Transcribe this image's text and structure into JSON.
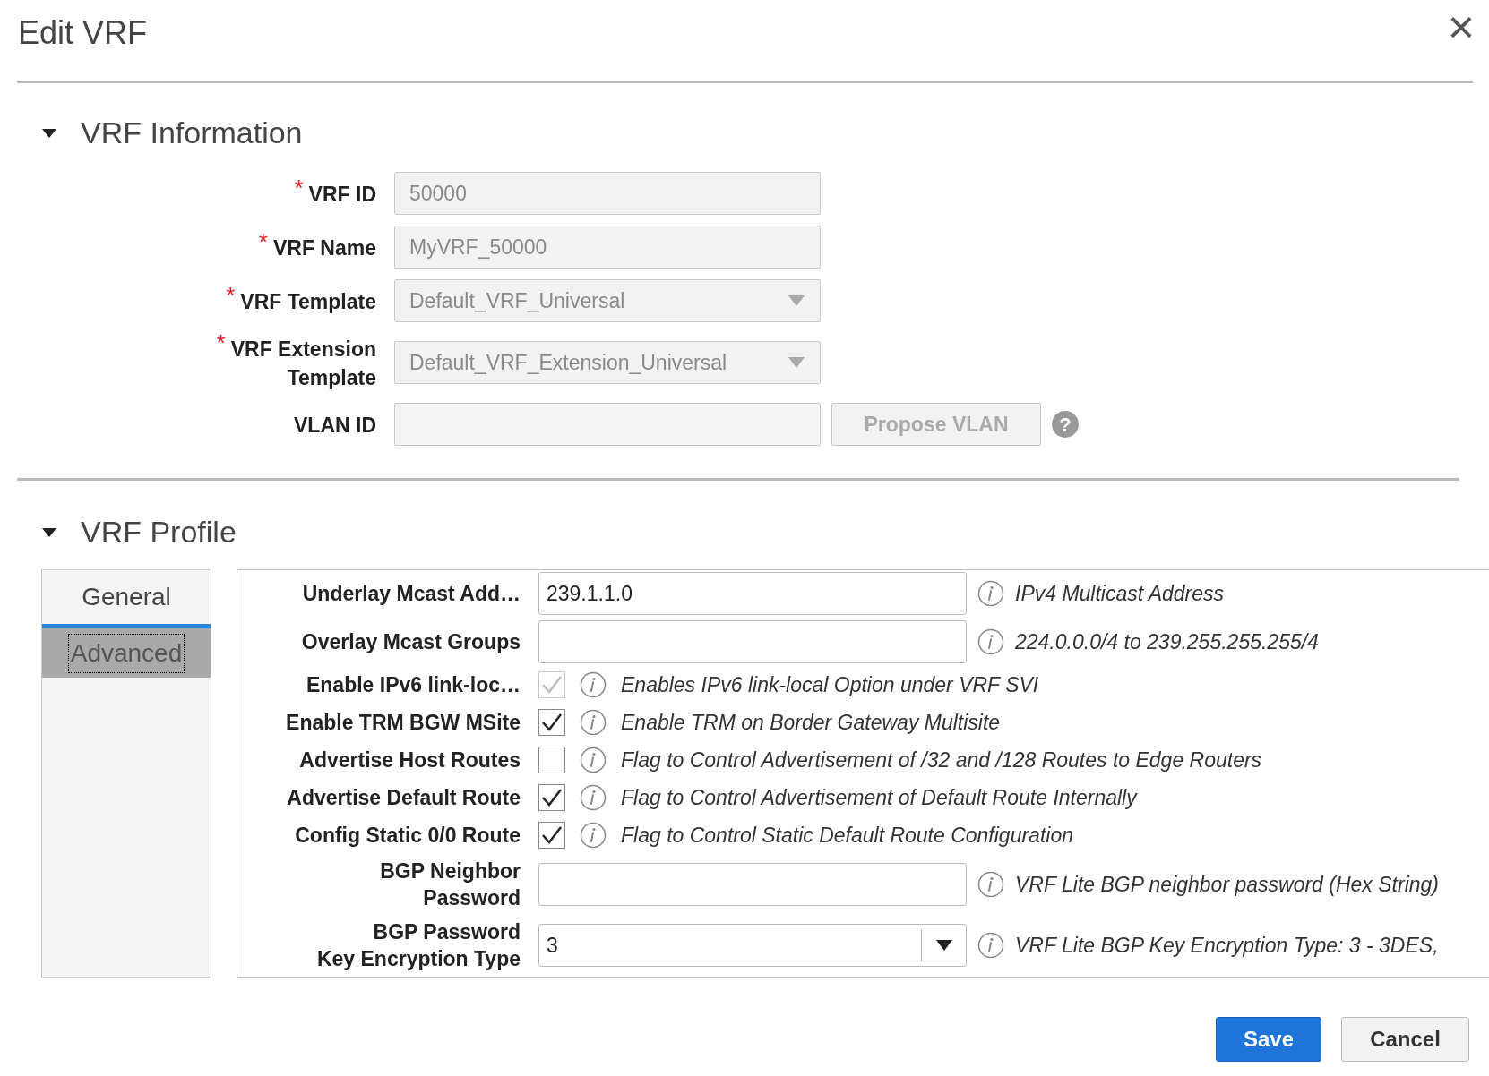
{
  "dialog": {
    "title": "Edit VRF",
    "close": "×"
  },
  "vrf_information": {
    "title": "VRF Information",
    "expanded": true,
    "fields": [
      {
        "kind": "input",
        "label": "VRF ID",
        "required_mark": "*",
        "value": "50000",
        "disabled": true
      },
      {
        "kind": "input",
        "label": "VRF Name",
        "required_mark": "*",
        "value": "MyVRF_50000",
        "disabled": true
      },
      {
        "kind": "select",
        "label": "VRF Template",
        "required_mark": "*",
        "value": "Default_VRF_Universal",
        "disabled": true
      },
      {
        "kind": "select",
        "label": "VRF Extension\nTemplate",
        "required_mark": "*",
        "value": "Default_VRF_Extension_Universal",
        "disabled": true
      },
      {
        "kind": "vlan",
        "label": "VLAN ID",
        "disabled": false,
        "button": "Propose VLAN",
        "help": "?"
      }
    ]
  },
  "vrf_profile": {
    "title": "VRF Profile",
    "expanded": true,
    "tabs": [
      {
        "label": "General",
        "selected": false
      },
      {
        "label": "Advanced",
        "selected": true
      }
    ],
    "rows": [
      {
        "kind": "input",
        "label": "Underlay Mcast Add…",
        "value": "239.1.1.0",
        "hint": "IPv4 Multicast Address"
      },
      {
        "kind": "input",
        "label": "Overlay Mcast Groups",
        "value": "",
        "hint": "224.0.0.0/4 to 239.255.255.255/4"
      },
      {
        "kind": "checkbox",
        "label": "Enable IPv6 link-loc…",
        "checked": true,
        "disabled": true,
        "hint": "Enables IPv6 link-local Option under VRF SVI"
      },
      {
        "kind": "checkbox",
        "label": "Enable TRM BGW MSite",
        "checked": true,
        "disabled": false,
        "hint": "Enable TRM on Border Gateway Multisite"
      },
      {
        "kind": "checkbox",
        "label": "Advertise Host Routes",
        "checked": false,
        "disabled": false,
        "hint": "Flag to Control Advertisement of /32 and /128 Routes to Edge Routers"
      },
      {
        "kind": "checkbox",
        "label": "Advertise Default Route",
        "checked": true,
        "disabled": false,
        "hint": "Flag to Control Advertisement of Default Route Internally"
      },
      {
        "kind": "checkbox",
        "label": "Config Static 0/0 Route",
        "checked": true,
        "disabled": false,
        "hint": "Flag to Control Static Default Route Configuration"
      },
      {
        "kind": "input",
        "label": "BGP Neighbor\nPassword",
        "value": "",
        "hint": "VRF Lite BGP neighbor password (Hex String)"
      },
      {
        "kind": "select",
        "label": "BGP Password\nKey Encryption Type",
        "value": "3",
        "hint": "VRF Lite BGP Key Encryption Type: 3 - 3DES,"
      }
    ]
  },
  "buttons": [
    {
      "kind": "primary",
      "label": "Save"
    },
    {
      "kind": "secondary",
      "label": "Cancel"
    }
  ]
}
